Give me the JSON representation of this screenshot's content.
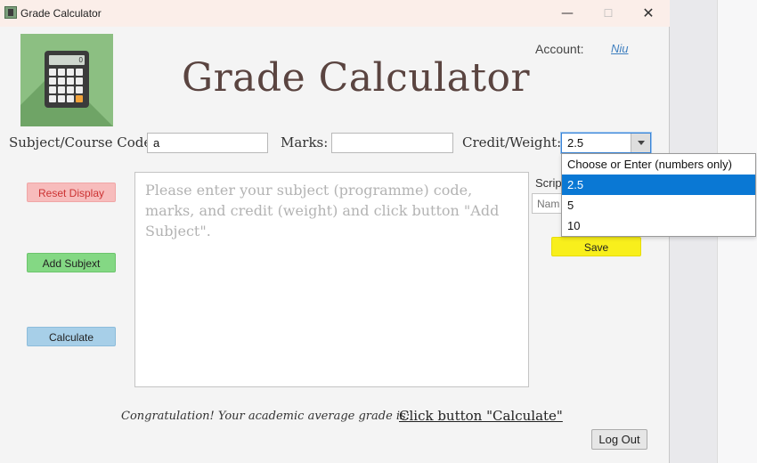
{
  "window": {
    "title": "Grade Calculator",
    "controls": {
      "minimize": "—",
      "maximize": "☐",
      "close": "✕"
    }
  },
  "header": {
    "title": "Grade Calculator",
    "account_label": "Account:",
    "account_name": "Niu"
  },
  "form": {
    "subject_label": "Subject/Course Code:",
    "subject_value": "a",
    "marks_label": "Marks:",
    "marks_value": "",
    "credit_label": "Credit/Weight:",
    "credit_value": "2.5",
    "credit_options": [
      "Choose or Enter (numbers only)",
      "2.5",
      "5",
      "10"
    ],
    "credit_selected": "2.5"
  },
  "buttons": {
    "reset": "Reset Display",
    "add": "Add Subjext",
    "calculate": "Calculate",
    "save": "Save",
    "logout": "Log Out"
  },
  "display": {
    "placeholder": "Please enter your subject (programme) code, marks, and credit (weight) and click button \"Add Subject\"."
  },
  "side": {
    "script_label": "Scrip",
    "name_placeholder": "Nam"
  },
  "result": {
    "label": "Congratulation! Your academic average grade is:",
    "value": "Click button \"Calculate\""
  },
  "colors": {
    "reset_bg": "#f7bcbc",
    "add_bg": "#84d884",
    "calculate_bg": "#a7cfe8",
    "save_bg": "#f8ef1c",
    "selection": "#0a78d4"
  },
  "icons": {
    "app": "calculator-icon",
    "logo": "calculator-icon"
  }
}
